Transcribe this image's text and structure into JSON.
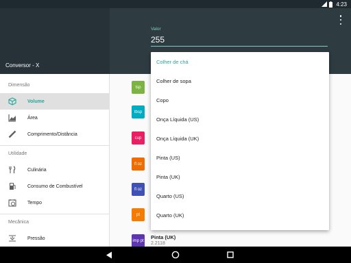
{
  "status_bar": {
    "time": "4:23"
  },
  "app": {
    "title": "Conversor - X"
  },
  "header": {
    "value_label": "Valor",
    "value": "255"
  },
  "colors": {
    "accent": "#26a69a",
    "header_dark": "#263238",
    "header": "#2e3b41"
  },
  "drawer": {
    "sections": [
      {
        "title": "Dimensão"
      },
      {
        "title": "Utilidade"
      },
      {
        "title": "Mecânica"
      }
    ],
    "items": [
      {
        "label": "Volume",
        "icon": "cube-icon",
        "active": true
      },
      {
        "label": "Área",
        "icon": "area-chart-icon"
      },
      {
        "label": "Comprimento/Distância",
        "icon": "ruler-icon"
      },
      {
        "label": "Culinária",
        "icon": "utensils-icon"
      },
      {
        "label": "Consumo de Combustível",
        "icon": "fuel-pump-icon"
      },
      {
        "label": "Tempo",
        "icon": "clock-icon"
      },
      {
        "label": "Pressão",
        "icon": "pressure-icon"
      }
    ]
  },
  "units": [
    {
      "abbr": "tsp",
      "color": "#7cb342"
    },
    {
      "abbr": "tbsp",
      "color": "#00acc1"
    },
    {
      "abbr": "cup",
      "color": "#e91e63"
    },
    {
      "abbr": "fl oz",
      "color": "#ef6c00"
    },
    {
      "abbr": "fl oz",
      "color": "#3f51b5"
    },
    {
      "abbr": "pt",
      "color": "#f57c00"
    },
    {
      "abbr": "imp pt",
      "color": "#5e35b1",
      "name": "Pinta (UK)",
      "value": "2.2118"
    }
  ],
  "dropdown": {
    "items": [
      {
        "label": "Colher de chá",
        "selected": true
      },
      {
        "label": "Colher de sopa"
      },
      {
        "label": "Copo"
      },
      {
        "label": "Onça Líquida (US)"
      },
      {
        "label": "Onça Líquida (UK)"
      },
      {
        "label": "Pinta (US)"
      },
      {
        "label": "Pinta (UK)"
      },
      {
        "label": "Quarto (US)"
      },
      {
        "label": "Quarto (UK)"
      }
    ]
  }
}
